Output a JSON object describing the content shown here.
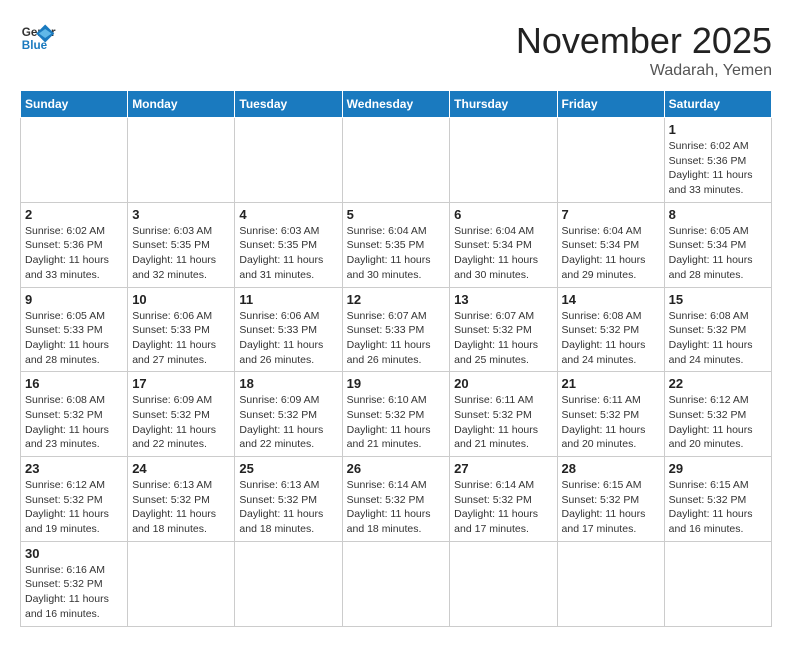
{
  "header": {
    "logo_general": "General",
    "logo_blue": "Blue",
    "month_title": "November 2025",
    "location": "Wadarah, Yemen"
  },
  "days_of_week": [
    "Sunday",
    "Monday",
    "Tuesday",
    "Wednesday",
    "Thursday",
    "Friday",
    "Saturday"
  ],
  "weeks": [
    [
      {
        "day": "",
        "info": ""
      },
      {
        "day": "",
        "info": ""
      },
      {
        "day": "",
        "info": ""
      },
      {
        "day": "",
        "info": ""
      },
      {
        "day": "",
        "info": ""
      },
      {
        "day": "",
        "info": ""
      },
      {
        "day": "1",
        "info": "Sunrise: 6:02 AM\nSunset: 5:36 PM\nDaylight: 11 hours\nand 33 minutes."
      }
    ],
    [
      {
        "day": "2",
        "info": "Sunrise: 6:02 AM\nSunset: 5:36 PM\nDaylight: 11 hours\nand 33 minutes."
      },
      {
        "day": "3",
        "info": "Sunrise: 6:03 AM\nSunset: 5:35 PM\nDaylight: 11 hours\nand 32 minutes."
      },
      {
        "day": "4",
        "info": "Sunrise: 6:03 AM\nSunset: 5:35 PM\nDaylight: 11 hours\nand 31 minutes."
      },
      {
        "day": "5",
        "info": "Sunrise: 6:04 AM\nSunset: 5:35 PM\nDaylight: 11 hours\nand 30 minutes."
      },
      {
        "day": "6",
        "info": "Sunrise: 6:04 AM\nSunset: 5:34 PM\nDaylight: 11 hours\nand 30 minutes."
      },
      {
        "day": "7",
        "info": "Sunrise: 6:04 AM\nSunset: 5:34 PM\nDaylight: 11 hours\nand 29 minutes."
      },
      {
        "day": "8",
        "info": "Sunrise: 6:05 AM\nSunset: 5:34 PM\nDaylight: 11 hours\nand 28 minutes."
      }
    ],
    [
      {
        "day": "9",
        "info": "Sunrise: 6:05 AM\nSunset: 5:33 PM\nDaylight: 11 hours\nand 28 minutes."
      },
      {
        "day": "10",
        "info": "Sunrise: 6:06 AM\nSunset: 5:33 PM\nDaylight: 11 hours\nand 27 minutes."
      },
      {
        "day": "11",
        "info": "Sunrise: 6:06 AM\nSunset: 5:33 PM\nDaylight: 11 hours\nand 26 minutes."
      },
      {
        "day": "12",
        "info": "Sunrise: 6:07 AM\nSunset: 5:33 PM\nDaylight: 11 hours\nand 26 minutes."
      },
      {
        "day": "13",
        "info": "Sunrise: 6:07 AM\nSunset: 5:32 PM\nDaylight: 11 hours\nand 25 minutes."
      },
      {
        "day": "14",
        "info": "Sunrise: 6:08 AM\nSunset: 5:32 PM\nDaylight: 11 hours\nand 24 minutes."
      },
      {
        "day": "15",
        "info": "Sunrise: 6:08 AM\nSunset: 5:32 PM\nDaylight: 11 hours\nand 24 minutes."
      }
    ],
    [
      {
        "day": "16",
        "info": "Sunrise: 6:08 AM\nSunset: 5:32 PM\nDaylight: 11 hours\nand 23 minutes."
      },
      {
        "day": "17",
        "info": "Sunrise: 6:09 AM\nSunset: 5:32 PM\nDaylight: 11 hours\nand 22 minutes."
      },
      {
        "day": "18",
        "info": "Sunrise: 6:09 AM\nSunset: 5:32 PM\nDaylight: 11 hours\nand 22 minutes."
      },
      {
        "day": "19",
        "info": "Sunrise: 6:10 AM\nSunset: 5:32 PM\nDaylight: 11 hours\nand 21 minutes."
      },
      {
        "day": "20",
        "info": "Sunrise: 6:11 AM\nSunset: 5:32 PM\nDaylight: 11 hours\nand 21 minutes."
      },
      {
        "day": "21",
        "info": "Sunrise: 6:11 AM\nSunset: 5:32 PM\nDaylight: 11 hours\nand 20 minutes."
      },
      {
        "day": "22",
        "info": "Sunrise: 6:12 AM\nSunset: 5:32 PM\nDaylight: 11 hours\nand 20 minutes."
      }
    ],
    [
      {
        "day": "23",
        "info": "Sunrise: 6:12 AM\nSunset: 5:32 PM\nDaylight: 11 hours\nand 19 minutes."
      },
      {
        "day": "24",
        "info": "Sunrise: 6:13 AM\nSunset: 5:32 PM\nDaylight: 11 hours\nand 18 minutes."
      },
      {
        "day": "25",
        "info": "Sunrise: 6:13 AM\nSunset: 5:32 PM\nDaylight: 11 hours\nand 18 minutes."
      },
      {
        "day": "26",
        "info": "Sunrise: 6:14 AM\nSunset: 5:32 PM\nDaylight: 11 hours\nand 18 minutes."
      },
      {
        "day": "27",
        "info": "Sunrise: 6:14 AM\nSunset: 5:32 PM\nDaylight: 11 hours\nand 17 minutes."
      },
      {
        "day": "28",
        "info": "Sunrise: 6:15 AM\nSunset: 5:32 PM\nDaylight: 11 hours\nand 17 minutes."
      },
      {
        "day": "29",
        "info": "Sunrise: 6:15 AM\nSunset: 5:32 PM\nDaylight: 11 hours\nand 16 minutes."
      }
    ],
    [
      {
        "day": "30",
        "info": "Sunrise: 6:16 AM\nSunset: 5:32 PM\nDaylight: 11 hours\nand 16 minutes."
      },
      {
        "day": "",
        "info": ""
      },
      {
        "day": "",
        "info": ""
      },
      {
        "day": "",
        "info": ""
      },
      {
        "day": "",
        "info": ""
      },
      {
        "day": "",
        "info": ""
      },
      {
        "day": "",
        "info": ""
      }
    ]
  ]
}
